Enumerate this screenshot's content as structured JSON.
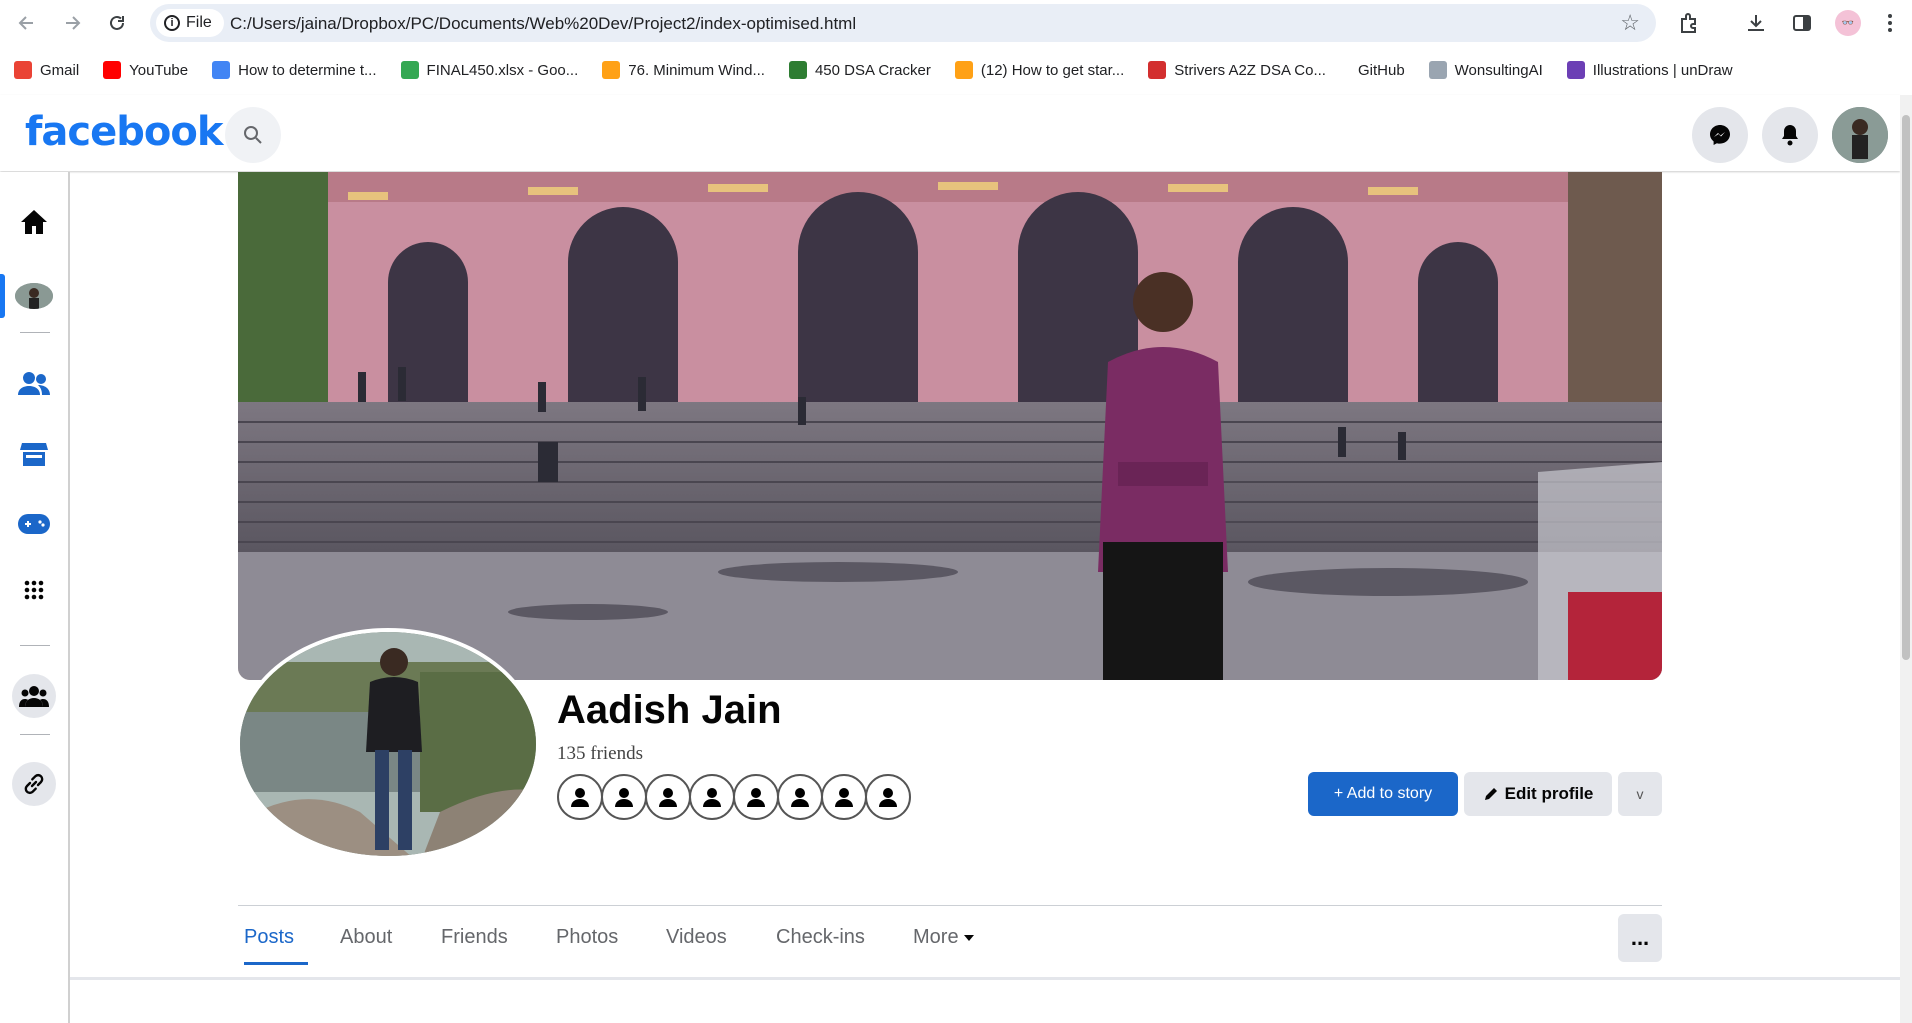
{
  "browser": {
    "file_chip": "File",
    "url": "C:/Users/jaina/Dropbox/PC/Documents/Web%20Dev/Project2/index-optimised.html",
    "bookmarks": [
      {
        "label": "Gmail",
        "color": "#ea4335"
      },
      {
        "label": "YouTube",
        "color": "#ff0000"
      },
      {
        "label": "How to determine t...",
        "color": "#4285f4"
      },
      {
        "label": "FINAL450.xlsx - Goo...",
        "color": "#34a853"
      },
      {
        "label": "76. Minimum Wind...",
        "color": "#ffa116"
      },
      {
        "label": "450 DSA Cracker",
        "color": "#2e7d32"
      },
      {
        "label": "(12) How to get star...",
        "color": "#ffa116"
      },
      {
        "label": "Strivers A2Z DSA Co...",
        "color": "#d32f2f"
      },
      {
        "label": "GitHub",
        "color": "#ffffff"
      },
      {
        "label": "WonsultingAI",
        "color": "#9aa5b1"
      },
      {
        "label": "Illustrations | unDraw",
        "color": "#6c3fb5"
      }
    ]
  },
  "header": {
    "logo": "facebook",
    "brand_color": "#1877f2"
  },
  "profile": {
    "name": "Aadish Jain",
    "friends_count": "135 friends",
    "friend_avatars": 8,
    "add_story_label": "+ Add to story",
    "edit_profile_label": "Edit profile",
    "more_label": "v"
  },
  "tabs": [
    {
      "label": "Posts",
      "active": true
    },
    {
      "label": "About"
    },
    {
      "label": "Friends"
    },
    {
      "label": "Photos"
    },
    {
      "label": "Videos"
    },
    {
      "label": "Check-ins"
    },
    {
      "label": "More"
    }
  ],
  "tab_more_menu": "..."
}
